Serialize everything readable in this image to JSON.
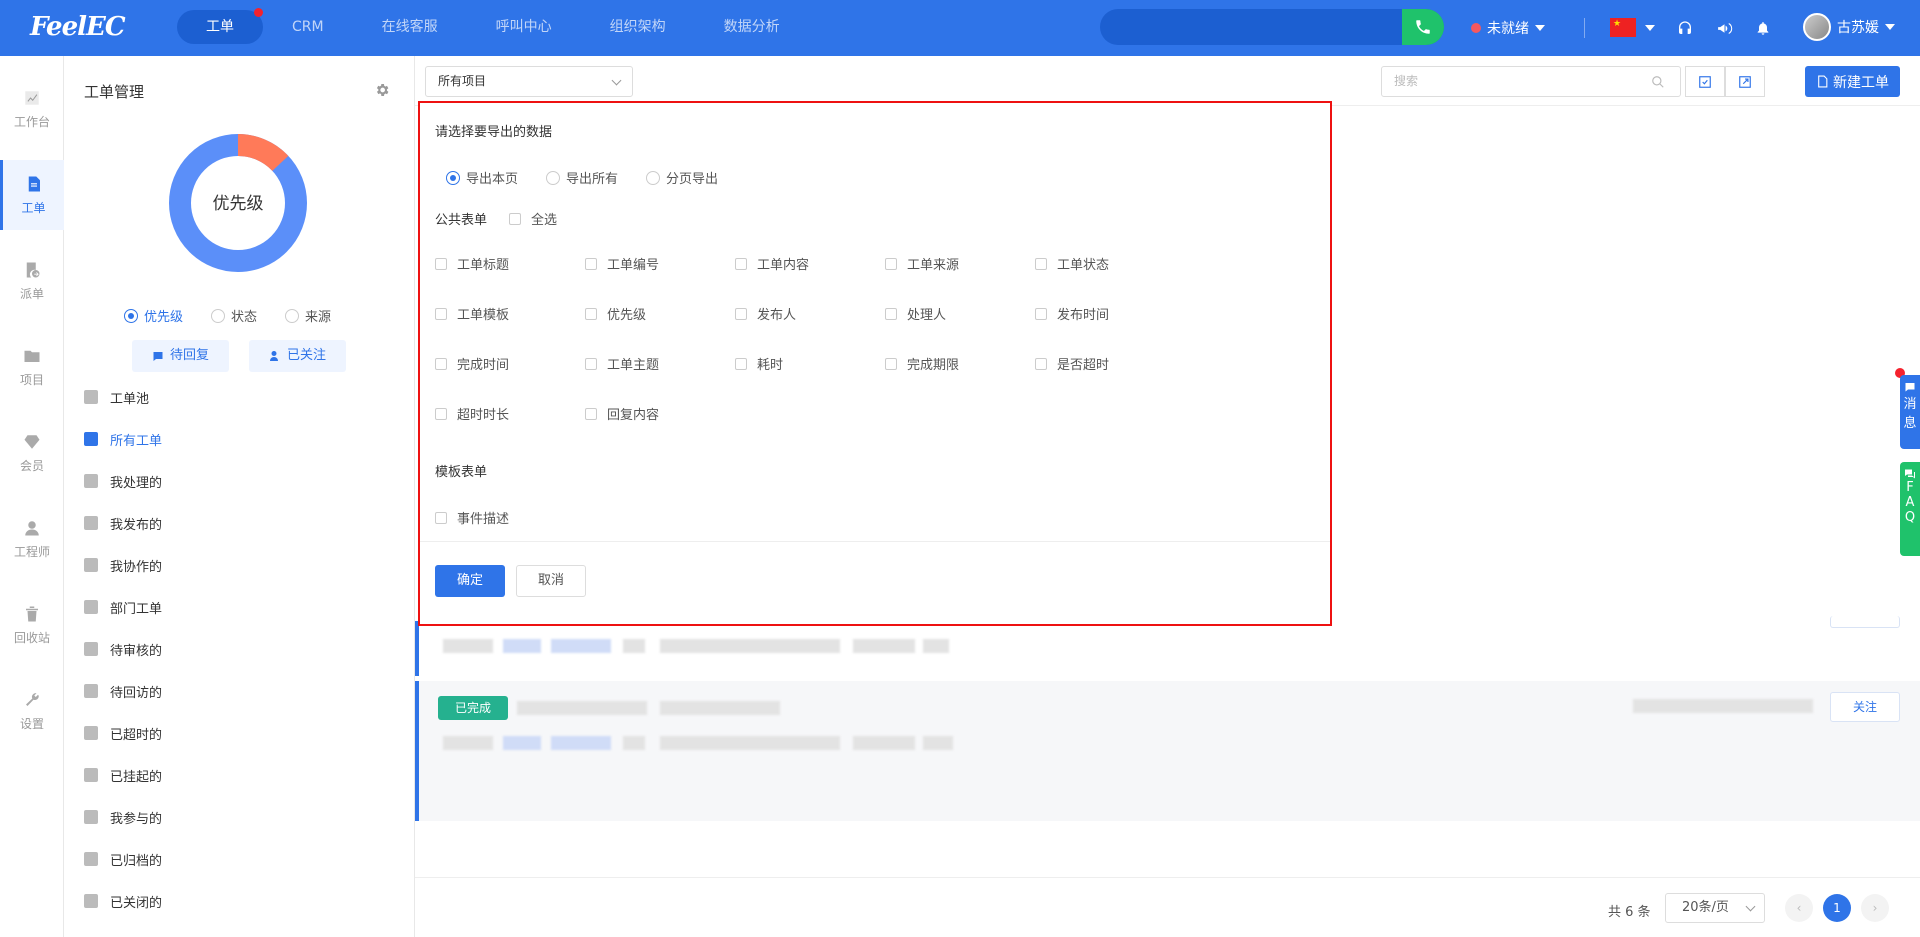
{
  "brand": "FeelEC",
  "nav": [
    "工单",
    "CRM",
    "在线客服",
    "呼叫中心",
    "组织架构",
    "数据分析"
  ],
  "top": {
    "status": "未就绪",
    "user": "古苏媛"
  },
  "rail": [
    "工作台",
    "工单",
    "派单",
    "项目",
    "会员",
    "工程师",
    "回收站",
    "设置"
  ],
  "sidebar": {
    "title": "工单管理",
    "donut_label": "优先级",
    "donut_fraction": 0.13,
    "radios": [
      "优先级",
      "状态",
      "来源"
    ],
    "tag_buttons": [
      "待回复",
      "已关注"
    ],
    "menu": [
      "工单池",
      "所有工单",
      "我处理的",
      "我发布的",
      "我协作的",
      "部门工单",
      "待审核的",
      "待回访的",
      "已超时的",
      "已挂起的",
      "我参与的",
      "已归档的",
      "已关闭的"
    ]
  },
  "toolbar": {
    "project": "所有项目",
    "search_placeholder": "搜索",
    "new_label": "新建工单"
  },
  "export": {
    "title": "请选择要导出的数据",
    "modes": [
      "导出本页",
      "导出所有",
      "分页导出"
    ],
    "public_label": "公共表单",
    "select_all": "全选",
    "public_fields": [
      "工单标题",
      "工单编号",
      "工单内容",
      "工单来源",
      "工单状态",
      "工单模板",
      "优先级",
      "发布人",
      "处理人",
      "发布时间",
      "完成时间",
      "工单主题",
      "耗时",
      "完成期限",
      "是否超时",
      "超时时长",
      "回复内容"
    ],
    "template_label": "模板表单",
    "template_fields": [
      "事件描述"
    ],
    "ok": "确定",
    "cancel": "取消"
  },
  "list": {
    "done_tag": "已完成",
    "follow": "关注"
  },
  "pager": {
    "total": "共 6 条",
    "size": "20条/页",
    "current": "1"
  },
  "float": {
    "msg": [
      "消",
      "息"
    ],
    "faq": [
      "F",
      "A",
      "Q"
    ]
  }
}
